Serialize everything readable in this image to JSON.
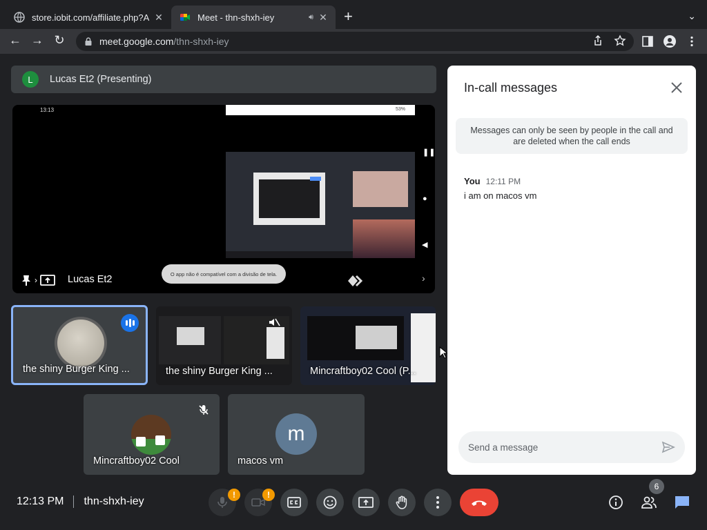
{
  "browser": {
    "tabs": [
      {
        "title": "store.iobit.com/affiliate.php?AC",
        "active": false,
        "favicon": "globe-icon"
      },
      {
        "title": "Meet - thn-shxh-iey",
        "active": true,
        "favicon": "meet-icon"
      }
    ],
    "url_host": "meet.google.com",
    "url_path": "/thn-shxh-iey"
  },
  "presenting": {
    "avatar_letter": "L",
    "label": "Lucas Et2 (Presenting)"
  },
  "stage": {
    "presenter_name": "Lucas Et2",
    "phone_time": "13:13",
    "phone_battery": "53%",
    "toast": "O app não é compatível com a divisão de tela."
  },
  "tiles": [
    {
      "name": "the shiny Burger King ...",
      "selected": true,
      "speaking": true
    },
    {
      "name": "the shiny Burger King ...",
      "muted": true
    },
    {
      "name": "Mincraftboy02 Cool (P..."
    },
    {
      "name": "Mincraftboy02 Cool",
      "muted": true
    },
    {
      "name": "macos vm",
      "avatar_letter": "m"
    }
  ],
  "chat": {
    "title": "In-call messages",
    "info": "Messages can only be seen by people in the call and are deleted when the call ends",
    "messages": [
      {
        "sender": "You",
        "time": "12:11 PM",
        "text": "i am on macos vm"
      }
    ],
    "input_placeholder": "Send a message"
  },
  "footer": {
    "time": "12:13 PM",
    "meeting_code": "thn-shxh-iey",
    "participant_count": "6",
    "alert_mark": "!"
  },
  "colors": {
    "end_call": "#ea4335",
    "accent": "#8ab4f8",
    "alert": "#f29900"
  }
}
